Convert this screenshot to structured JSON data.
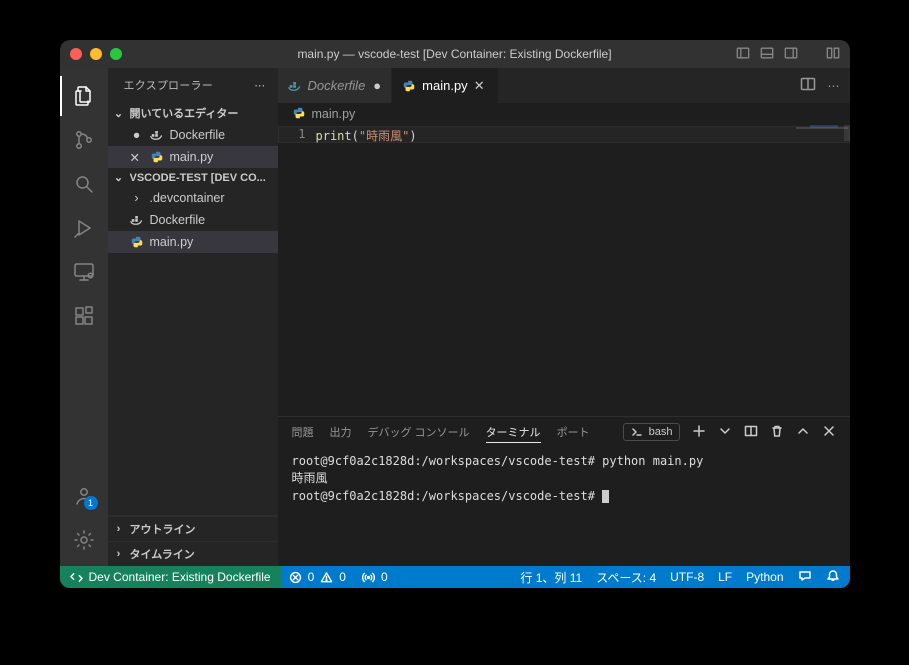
{
  "title": "main.py — vscode-test [Dev Container: Existing Dockerfile]",
  "sidebar": {
    "header": "エクスプローラー",
    "openEditorsLabel": "開いているエディター",
    "openEditors": [
      {
        "icon": "docker",
        "name": "Dockerfile",
        "modified": true,
        "active": false
      },
      {
        "icon": "python",
        "name": "main.py",
        "modified": false,
        "active": true
      }
    ],
    "folderLabel": "VSCODE-TEST [DEV CO...",
    "folder": [
      {
        "icon": "chev",
        "name": ".devcontainer"
      },
      {
        "icon": "docker",
        "name": "Dockerfile"
      },
      {
        "icon": "python",
        "name": "main.py",
        "active": true
      }
    ],
    "outline": "アウトライン",
    "timeline": "タイムライン"
  },
  "tabs": [
    {
      "icon": "docker",
      "label": "Dockerfile",
      "active": false
    },
    {
      "icon": "python",
      "label": "main.py",
      "active": true
    }
  ],
  "breadcrumb": {
    "icon": "python",
    "label": "main.py"
  },
  "editor": {
    "lineno": "1",
    "code": {
      "func": "print",
      "open": "(",
      "str": "\"時雨風\"",
      "close": ")"
    }
  },
  "panel": {
    "tabs": [
      "問題",
      "出力",
      "デバッグ コンソール",
      "ターミナル",
      "ポート"
    ],
    "activeTab": 3,
    "shell": "bash",
    "lines": [
      "root@9cf0a2c1828d:/workspaces/vscode-test# python main.py",
      "時雨風",
      "root@9cf0a2c1828d:/workspaces/vscode-test# "
    ]
  },
  "status": {
    "remote": "Dev Container: Existing Dockerfile",
    "errors": "0",
    "warnings": "0",
    "ports": "0",
    "lncol": "行 1、列 11",
    "spaces": "スペース: 4",
    "enc": "UTF-8",
    "eol": "LF",
    "lang": "Python"
  },
  "accountBadge": "1"
}
